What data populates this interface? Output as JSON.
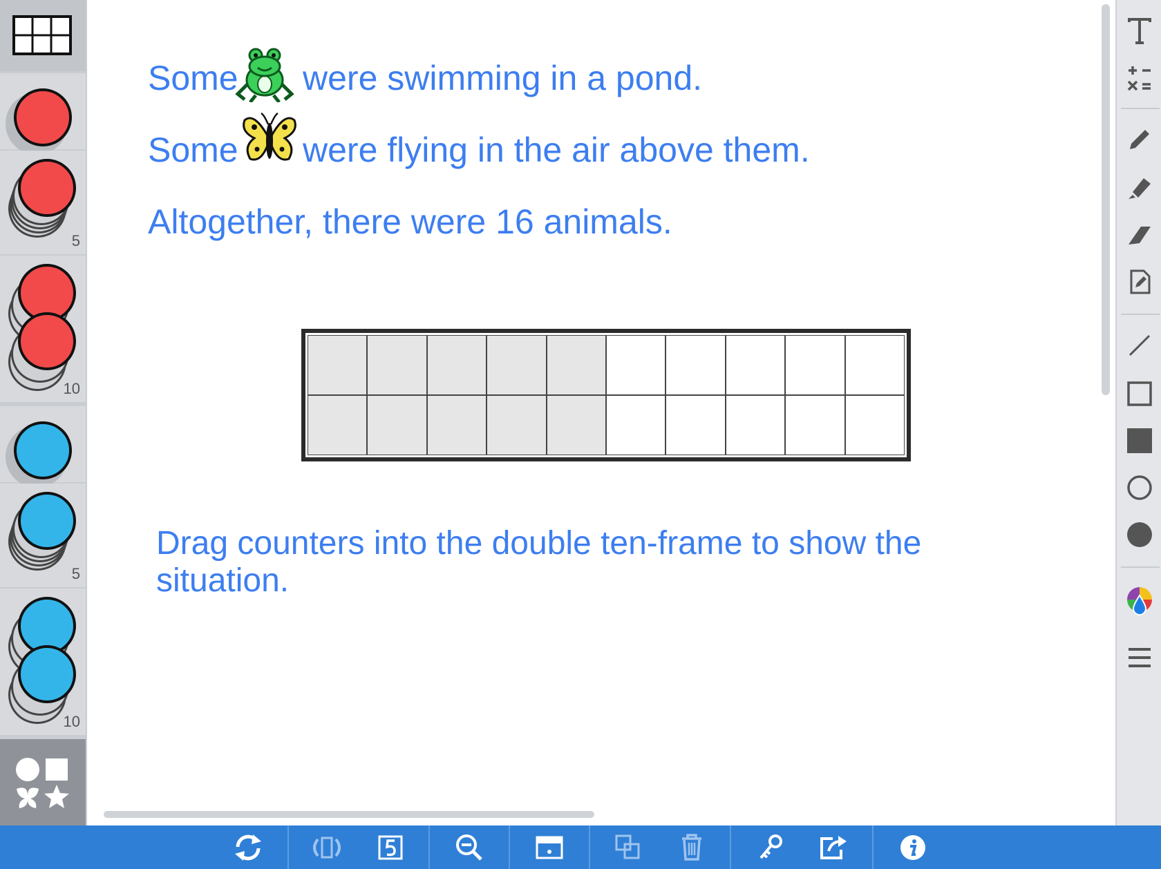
{
  "story": {
    "line1_pre": "Some",
    "line1_post": "were swimming in a pond.",
    "line2_pre": "Some",
    "line2_post": "were flying in the air above them.",
    "line3": "Altogether, there were 16 animals."
  },
  "instruction": "Drag counters into the double ten-frame to show the situation.",
  "palette": {
    "red_stack_5_label": "5",
    "red_stack_10_label": "10",
    "blue_stack_5_label": "5",
    "blue_stack_10_label": "10",
    "colors": {
      "red": "#f24a4a",
      "blue": "#34b5ea"
    }
  },
  "ten_frame": {
    "rows": 2,
    "columns": 10,
    "shaded_columns": 5
  },
  "right_toolbar": [
    "text-tool",
    "math-symbols-tool",
    "pen-tool",
    "highlighter-tool",
    "eraser-tool",
    "note-tool",
    "line-tool",
    "rectangle-tool",
    "filled-rectangle-tool",
    "circle-tool",
    "filled-circle-tool",
    "color-picker",
    "menu"
  ],
  "bottom_toolbar": [
    "reset",
    "flip",
    "number-frame",
    "zoom-out",
    "frame",
    "duplicate",
    "trash",
    "key",
    "share",
    "info"
  ],
  "accent_color": "#2f7fd6",
  "text_color": "#3d7ef0"
}
